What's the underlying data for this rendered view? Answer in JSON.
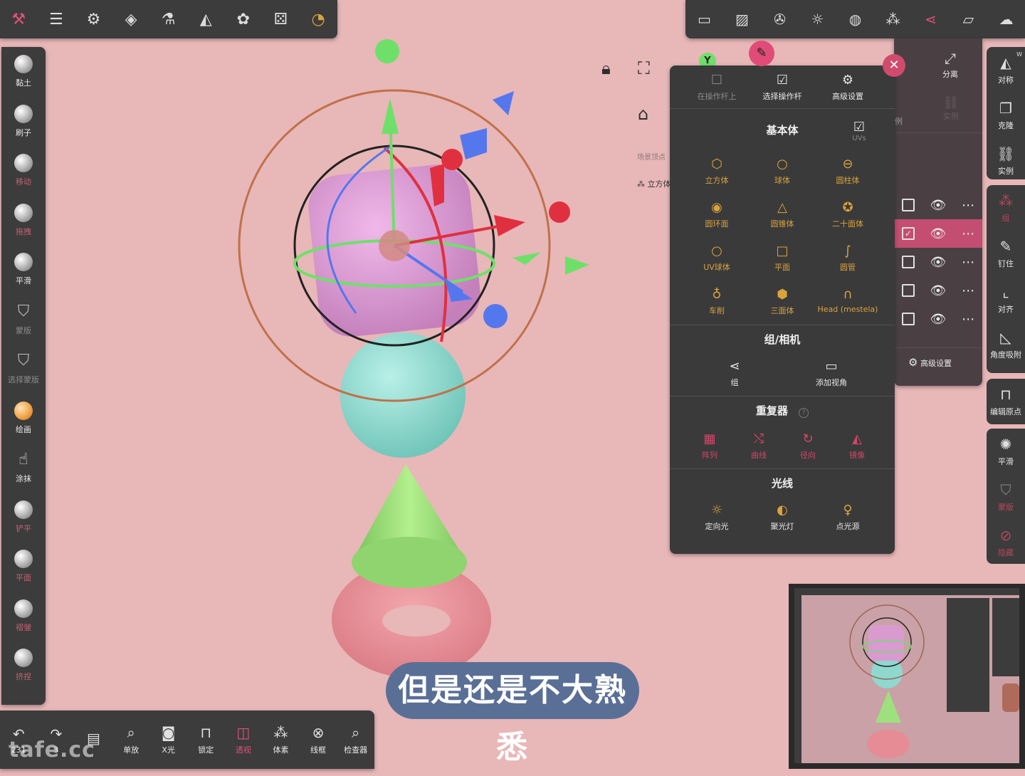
{
  "top_left_toolbar": {
    "icons": [
      "tools-icon",
      "sliders-icon",
      "settings-icon",
      "layers-icon",
      "flask-icon",
      "symmetry-icon",
      "palette-icon",
      "dice-icon",
      "gizmo-icon"
    ]
  },
  "top_right_toolbar": {
    "icons": [
      "camera-icon",
      "image-icon",
      "aperture-icon",
      "sun-icon",
      "globe-icon",
      "cubes-icon",
      "share-nodes-icon",
      "folder-icon",
      "cloud-icon"
    ]
  },
  "left_tools": [
    {
      "label": "黏土",
      "state": "normal"
    },
    {
      "label": "刷子",
      "state": "normal"
    },
    {
      "label": "移动",
      "state": "dim"
    },
    {
      "label": "拖拽",
      "state": "dim"
    },
    {
      "label": "平滑",
      "state": "normal"
    },
    {
      "label": "蒙版",
      "state": "off"
    },
    {
      "label": "选择蒙版",
      "state": "off"
    },
    {
      "label": "绘画",
      "state": "normal"
    },
    {
      "label": "涂抹",
      "state": "normal"
    },
    {
      "label": "铲平",
      "state": "dim"
    },
    {
      "label": "平面",
      "state": "dim"
    },
    {
      "label": "褶皱",
      "state": "dim"
    },
    {
      "label": "挤捏",
      "state": "dim"
    }
  ],
  "right_tools": {
    "group1": [
      {
        "label": "对称"
      },
      {
        "label": "克隆"
      },
      {
        "label": "实例"
      }
    ],
    "group2": [
      {
        "label": "组",
        "dim": true
      },
      {
        "label": "钉住"
      },
      {
        "label": "对齐"
      },
      {
        "label": "角度吸附"
      }
    ],
    "group3": [
      {
        "label": "编辑原点"
      }
    ],
    "group4": [
      {
        "label": "平滑"
      },
      {
        "label": "蒙版",
        "dim": true
      },
      {
        "label": "隐藏",
        "dim": true
      }
    ],
    "w_badge": "W"
  },
  "split_panel": {
    "split_label": "分离",
    "instance_label": "实例",
    "example_label": "例",
    "advanced": "高级设置"
  },
  "scene_panel": {
    "hint": "场景顶点",
    "object_name": "立方体"
  },
  "add_menu": {
    "header": [
      {
        "label": "在操作杆上",
        "state": "off",
        "icon": "square-icon"
      },
      {
        "label": "选择操作杆",
        "state": "on",
        "icon": "check-square-icon"
      },
      {
        "label": "高级设置",
        "state": "on",
        "icon": "gear-icon"
      }
    ],
    "primitives_title": "基本体",
    "uvs_label": "UVs",
    "primitives": [
      {
        "label": "立方体",
        "glyph": "⬡",
        "color": "gold"
      },
      {
        "label": "球体",
        "glyph": "○",
        "color": "gold"
      },
      {
        "label": "圆柱体",
        "glyph": "⊖",
        "color": "gold"
      },
      {
        "label": "圆环面",
        "glyph": "◉",
        "color": "gold"
      },
      {
        "label": "圆锥体",
        "glyph": "△",
        "color": "gold"
      },
      {
        "label": "二十面体",
        "glyph": "✪",
        "color": "gold"
      },
      {
        "label": "UV球体",
        "glyph": "○",
        "color": "gold"
      },
      {
        "label": "平面",
        "glyph": "□",
        "color": "gold"
      },
      {
        "label": "圆管",
        "glyph": "∫",
        "color": "gold"
      },
      {
        "label": "车削",
        "glyph": "♁",
        "color": "gold"
      },
      {
        "label": "三面体",
        "glyph": "⬢",
        "color": "gold"
      },
      {
        "label": "Head (mestela)",
        "glyph": "∩",
        "color": "gold"
      }
    ],
    "group_title": "组/相机",
    "group_items": [
      {
        "label": "组",
        "glyph": "⋖"
      },
      {
        "label": "添加视角",
        "glyph": "▭"
      }
    ],
    "repeater_title": "重复器",
    "repeater_help": "?",
    "repeaters": [
      {
        "label": "阵列",
        "glyph": "▦"
      },
      {
        "label": "曲线",
        "glyph": "⤭"
      },
      {
        "label": "径向",
        "glyph": "↻"
      },
      {
        "label": "镜像",
        "glyph": "◭"
      }
    ],
    "lights_title": "光线",
    "lights": [
      {
        "label": "定向光",
        "glyph": "☼"
      },
      {
        "label": "聚光灯",
        "glyph": "◐"
      },
      {
        "label": "点光源",
        "glyph": "♀"
      }
    ]
  },
  "viewport": {
    "axis_label": "Y"
  },
  "bottom_tools": [
    {
      "label": "231",
      "icon": "undo-icon",
      "glyph": "↶",
      "pink": false
    },
    {
      "label": "3",
      "icon": "redo-icon",
      "glyph": "↷",
      "pink": false
    },
    {
      "label": "",
      "icon": "notebook-icon",
      "glyph": "▤",
      "pink": false
    },
    {
      "label": "单放",
      "icon": "search-icon",
      "glyph": "⌕",
      "pink": false
    },
    {
      "label": "X光",
      "icon": "glasses-icon",
      "glyph": "◙",
      "pink": false
    },
    {
      "label": "锁定",
      "icon": "lock-icon",
      "glyph": "⊓",
      "pink": false
    },
    {
      "label": "透视",
      "icon": "perspective-icon",
      "glyph": "◫",
      "pink": true
    },
    {
      "label": "体素",
      "icon": "voxel-icon",
      "glyph": "⁂",
      "pink": false
    },
    {
      "label": "线框",
      "icon": "wireframe-icon",
      "glyph": "⊗",
      "pink": false
    },
    {
      "label": "检查器",
      "icon": "inspector-icon",
      "glyph": "⌕",
      "pink": false
    }
  ],
  "watermark": "tafe.cc",
  "subtitle": "但是还是不大熟悉",
  "colors": {
    "background": "#e8b7b8",
    "panel": "#3c3c3c",
    "accent": "#d14668",
    "gold": "#d9a33d",
    "cube": "#d99ad0",
    "sphere": "#8fd8cf",
    "cone": "#9ee07e",
    "torus": "#e58c94"
  }
}
